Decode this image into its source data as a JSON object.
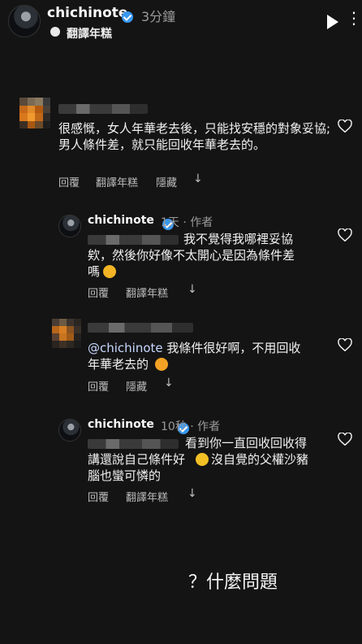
{
  "header": {
    "username": "chichinote",
    "time": "3分鐘",
    "translate_label": "翻譯年糕"
  },
  "comments": [
    {
      "text": "很感慨，女人年華老去後，只能找安穩的對象妥協;男人條件差，就只能回收年華老去的。",
      "actions": [
        "回覆",
        "翻譯年糕",
        "隱藏"
      ]
    },
    {
      "username": "chichinote",
      "meta": "1天 · 作者",
      "text_line1": "我不覺得我哪裡妥協",
      "text_line2": "欸，然後你好像不太開心是因為條件差",
      "text_line3": "嗎",
      "actions": [
        "回覆",
        "翻譯年糕"
      ]
    },
    {
      "mention": "@chichinote",
      "text_line1": " 我條件很好啊，不用回收",
      "text_line2": "年華老去的",
      "actions": [
        "回覆",
        "隱藏"
      ]
    },
    {
      "username": "chichinote",
      "meta": "10秒 · 作者",
      "text_line1": "看到你一直回收回收得",
      "text_line2": "講還說自己條件好",
      "text_line2b": "沒自覺的父權沙豬",
      "text_line3": "腦也蠻可憐的",
      "actions": [
        "回覆",
        "翻譯年糕"
      ]
    }
  ],
  "bottom_caption": "？什麼問題",
  "colors": {
    "background": "#141414",
    "verified": "#3897f0",
    "muted": "#9a9a9a"
  }
}
